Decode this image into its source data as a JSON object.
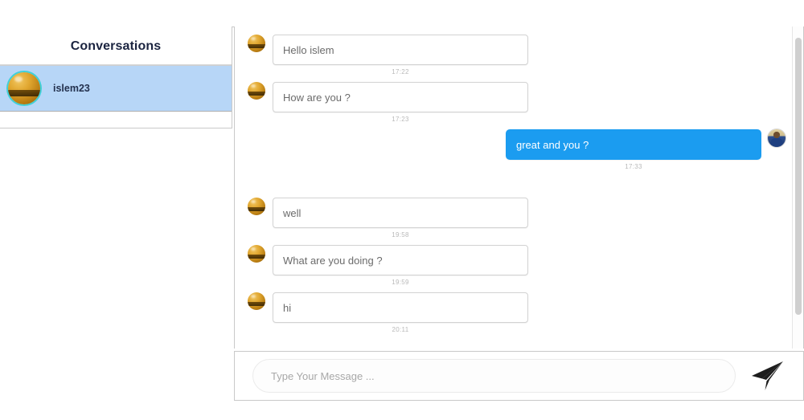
{
  "sidebar": {
    "title": "Conversations",
    "conversations": [
      {
        "name": "islem23",
        "avatar": "sphere-avatar",
        "selected": true
      }
    ]
  },
  "chat": {
    "messages": [
      {
        "direction": "in",
        "text": "Hello islem",
        "time": "17:22",
        "avatar": "sphere-avatar"
      },
      {
        "direction": "in",
        "text": "How are you ?",
        "time": "17:23",
        "avatar": "sphere-avatar"
      },
      {
        "direction": "out",
        "text": "great and you ?",
        "time": "17:33",
        "avatar": "photo-avatar"
      },
      {
        "direction": "in",
        "text": "well",
        "time": "19:58",
        "avatar": "sphere-avatar"
      },
      {
        "direction": "in",
        "text": "What are you doing ?",
        "time": "19:59",
        "avatar": "sphere-avatar"
      },
      {
        "direction": "in",
        "text": "hi",
        "time": "20:11",
        "avatar": "sphere-avatar"
      }
    ]
  },
  "composer": {
    "placeholder": "Type Your Message ...",
    "value": "",
    "send_icon": "paper-plane-icon"
  },
  "colors": {
    "outgoing_bubble": "#1b9cf0",
    "selected_conversation": "#b7d6f7",
    "title_text": "#1b2440",
    "bubble_border": "#d2d2d2",
    "timestamp_text": "#b9b9b9"
  }
}
